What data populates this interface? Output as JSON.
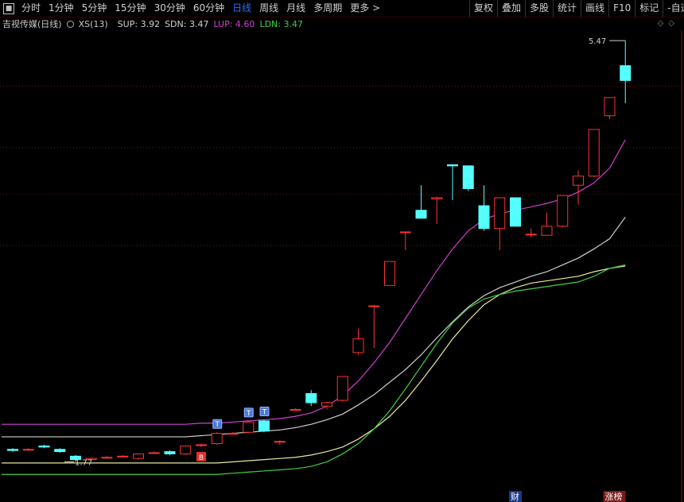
{
  "toolbar": {
    "icon": "■",
    "periods": [
      "分时",
      "1分钟",
      "5分钟",
      "15分钟",
      "30分钟",
      "60分钟",
      "日线",
      "周线",
      "月线",
      "多周期",
      "更多 >"
    ],
    "active_index": 6,
    "right_items": [
      "复权",
      "叠加",
      "多股",
      "统计",
      "画线",
      "F10",
      "标记",
      "-自选"
    ]
  },
  "info": {
    "stock": "吉视传媒(日线)",
    "indicator": "XS(13)",
    "sup": "SUP: 3.92",
    "sdn": "SDN: 3.47",
    "lup": "LUP: 4.60",
    "ldn": "LDN: 3.47",
    "colors": {
      "sup": "#d0d0d0",
      "sdn": "#d0d0d0",
      "lup": "#d040d0",
      "ldn": "#40d040"
    }
  },
  "top_right_icons": "◇◇",
  "markers": {
    "high_label": "5.47",
    "low_label": "1.77",
    "buy_tag": "B",
    "t_tag": "T"
  },
  "events": {
    "cai": "财",
    "zhangbang": "涨榜"
  },
  "chart_data": {
    "type": "candlestick",
    "title": "",
    "candles": [
      {
        "o": 1.88,
        "h": 1.89,
        "l": 1.86,
        "c": 1.87
      },
      {
        "o": 1.88,
        "h": 1.89,
        "l": 1.87,
        "c": 1.88
      },
      {
        "o": 1.91,
        "h": 1.92,
        "l": 1.89,
        "c": 1.9
      },
      {
        "o": 1.88,
        "h": 1.89,
        "l": 1.85,
        "c": 1.86
      },
      {
        "o": 1.82,
        "h": 1.83,
        "l": 1.77,
        "c": 1.79
      },
      {
        "o": 1.79,
        "h": 1.81,
        "l": 1.78,
        "c": 1.8
      },
      {
        "o": 1.81,
        "h": 1.82,
        "l": 1.8,
        "c": 1.81
      },
      {
        "o": 1.82,
        "h": 1.83,
        "l": 1.81,
        "c": 1.82
      },
      {
        "o": 1.8,
        "h": 1.84,
        "l": 1.79,
        "c": 1.84
      },
      {
        "o": 1.85,
        "h": 1.86,
        "l": 1.84,
        "c": 1.85
      },
      {
        "o": 1.86,
        "h": 1.87,
        "l": 1.83,
        "c": 1.84
      },
      {
        "o": 1.84,
        "h": 1.91,
        "l": 1.83,
        "c": 1.91
      },
      {
        "o": 1.92,
        "h": 1.93,
        "l": 1.9,
        "c": 1.92
      },
      {
        "o": 1.93,
        "h": 2.03,
        "l": 1.92,
        "c": 2.02
      },
      {
        "o": 2.02,
        "h": 2.03,
        "l": 2.01,
        "c": 2.02
      },
      {
        "o": 2.03,
        "h": 2.13,
        "l": 2.03,
        "c": 2.12
      },
      {
        "o": 2.13,
        "h": 2.14,
        "l": 2.03,
        "c": 2.04
      },
      {
        "o": 1.95,
        "h": 1.96,
        "l": 1.92,
        "c": 1.95
      },
      {
        "o": 2.23,
        "h": 2.24,
        "l": 2.22,
        "c": 2.23
      },
      {
        "o": 2.37,
        "h": 2.4,
        "l": 2.26,
        "c": 2.29
      },
      {
        "o": 2.26,
        "h": 2.3,
        "l": 2.23,
        "c": 2.29
      },
      {
        "o": 2.31,
        "h": 2.52,
        "l": 2.3,
        "c": 2.52
      },
      {
        "o": 2.73,
        "h": 2.94,
        "l": 2.71,
        "c": 2.85
      },
      {
        "o": 3.14,
        "h": 3.15,
        "l": 2.77,
        "c": 3.14
      },
      {
        "o": 3.32,
        "h": 3.53,
        "l": 3.32,
        "c": 3.53
      },
      {
        "o": 3.79,
        "h": 3.79,
        "l": 3.63,
        "c": 3.79
      },
      {
        "o": 3.98,
        "h": 4.2,
        "l": 3.91,
        "c": 3.91
      },
      {
        "o": 4.08,
        "h": 4.1,
        "l": 3.86,
        "c": 4.09
      },
      {
        "o": 4.38,
        "h": 4.38,
        "l": 4.07,
        "c": 4.37
      },
      {
        "o": 4.37,
        "h": 4.37,
        "l": 4.15,
        "c": 4.17
      },
      {
        "o": 4.02,
        "h": 4.2,
        "l": 3.8,
        "c": 3.82
      },
      {
        "o": 3.82,
        "h": 4.09,
        "l": 3.63,
        "c": 4.09
      },
      {
        "o": 4.09,
        "h": 4.09,
        "l": 3.84,
        "c": 3.84
      },
      {
        "o": 3.77,
        "h": 3.82,
        "l": 3.74,
        "c": 3.77
      },
      {
        "o": 3.76,
        "h": 3.96,
        "l": 3.76,
        "c": 3.84
      },
      {
        "o": 3.84,
        "h": 4.11,
        "l": 3.83,
        "c": 4.11
      },
      {
        "o": 4.2,
        "h": 4.33,
        "l": 4.03,
        "c": 4.28
      },
      {
        "o": 4.28,
        "h": 4.69,
        "l": 4.27,
        "c": 4.69
      },
      {
        "o": 4.81,
        "h": 4.97,
        "l": 4.78,
        "c": 4.97
      },
      {
        "o": 5.25,
        "h": 5.47,
        "l": 4.92,
        "c": 5.12
      }
    ],
    "lines": [
      {
        "name": "SUP",
        "color": "#d0d0d0",
        "values": [
          1.99,
          1.99,
          1.99,
          1.99,
          1.99,
          1.99,
          1.99,
          1.99,
          1.99,
          1.99,
          1.99,
          1.99,
          2.0,
          2.01,
          2.02,
          2.03,
          2.04,
          2.05,
          2.07,
          2.1,
          2.14,
          2.19,
          2.27,
          2.36,
          2.47,
          2.58,
          2.71,
          2.86,
          3.0,
          3.13,
          3.23,
          3.3,
          3.35,
          3.4,
          3.44,
          3.5,
          3.56,
          3.64,
          3.73,
          3.92
        ]
      },
      {
        "name": "SDN",
        "color": "#e8e8a0",
        "values": [
          1.76,
          1.76,
          1.76,
          1.76,
          1.76,
          1.76,
          1.76,
          1.76,
          1.76,
          1.76,
          1.76,
          1.76,
          1.76,
          1.76,
          1.77,
          1.78,
          1.79,
          1.8,
          1.81,
          1.83,
          1.86,
          1.9,
          1.97,
          2.06,
          2.17,
          2.31,
          2.48,
          2.66,
          2.85,
          3.01,
          3.15,
          3.24,
          3.3,
          3.34,
          3.36,
          3.38,
          3.4,
          3.44,
          3.47,
          3.49
        ]
      },
      {
        "name": "LUP",
        "color": "#d040d0",
        "values": [
          2.1,
          2.1,
          2.1,
          2.1,
          2.1,
          2.1,
          2.1,
          2.1,
          2.1,
          2.1,
          2.1,
          2.1,
          2.11,
          2.11,
          2.12,
          2.13,
          2.14,
          2.15,
          2.17,
          2.2,
          2.26,
          2.35,
          2.48,
          2.64,
          2.82,
          3.03,
          3.24,
          3.45,
          3.64,
          3.8,
          3.9,
          3.95,
          3.98,
          4.01,
          4.04,
          4.08,
          4.14,
          4.22,
          4.35,
          4.6
        ]
      },
      {
        "name": "LDN",
        "color": "#40d040",
        "values": [
          1.66,
          1.66,
          1.66,
          1.66,
          1.66,
          1.66,
          1.66,
          1.66,
          1.66,
          1.66,
          1.66,
          1.66,
          1.66,
          1.66,
          1.67,
          1.68,
          1.69,
          1.7,
          1.71,
          1.73,
          1.77,
          1.84,
          1.93,
          2.06,
          2.22,
          2.41,
          2.61,
          2.81,
          2.99,
          3.12,
          3.2,
          3.24,
          3.27,
          3.29,
          3.31,
          3.33,
          3.35,
          3.4,
          3.47,
          3.5
        ]
      }
    ],
    "grid_prices": [
      5.07,
      4.53,
      4.12,
      3.67
    ],
    "buy_index": 12,
    "t_indices": [
      13,
      15,
      16
    ],
    "cai_index": 32,
    "zhangbang_index": 38
  }
}
